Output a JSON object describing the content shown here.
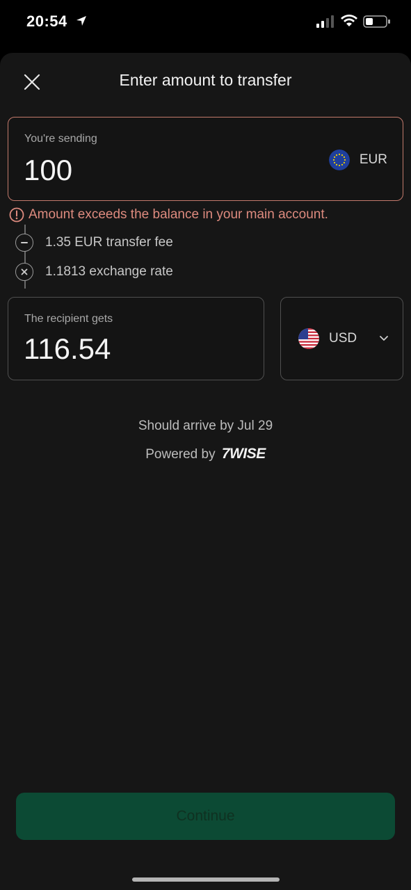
{
  "status_bar": {
    "time": "20:54"
  },
  "header": {
    "title": "Enter amount to transfer"
  },
  "send": {
    "label": "You're sending",
    "amount": "100",
    "currency": "EUR"
  },
  "error": {
    "message": "Amount exceeds the balance in your main account."
  },
  "breakdown": {
    "fee": "1.35 EUR transfer fee",
    "rate": "1.1813 exchange rate"
  },
  "receive": {
    "label": "The recipient gets",
    "amount": "116.54",
    "currency": "USD"
  },
  "info": {
    "arrival": "Should arrive by Jul 29",
    "powered_by": "Powered by",
    "brand": "7WISE"
  },
  "footer": {
    "continue_label": "Continue"
  },
  "colors": {
    "error": "#de8b7f",
    "continue_bg": "#0c4a34",
    "send_border": "#c37a6c"
  }
}
